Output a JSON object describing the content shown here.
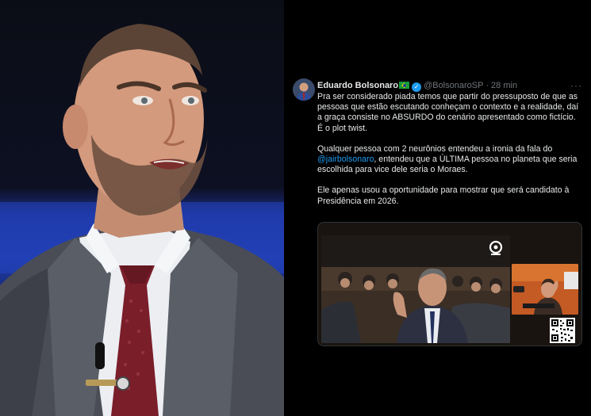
{
  "left_photo": {
    "subject": "man-in-suit-speaking",
    "colors": {
      "backdrop_blue": "#1f3aa3",
      "suit": "#4a4d55",
      "tie": "#7a1e2a"
    }
  },
  "tweet": {
    "author_name": "Eduardo Bolsonaro",
    "flag_icon": "brazil-flag-icon",
    "verified_icon": "verified-badge-icon",
    "handle": "@BolsonaroSP",
    "separator": "·",
    "time": "28 min",
    "more_icon": "···",
    "paragraph_1": "Pra ser considerado piada temos que partir do pressuposto de que as pessoas que estão escutando conheçam o contexto e a realidade, daí a graça consiste no ABSURDO do cenário apresentado como fictício. É o plot twist.",
    "paragraph_2_pre": "Qualquer pessoa com 2 neurônios entendeu a ironia da fala do ",
    "paragraph_2_mention": "@jairbolsonaro",
    "paragraph_2_post": ", entendeu que a ÚLTIMA pessoa no planeta que seria escolhida para vice dele seria o Moraes.",
    "paragraph_3": "Ele apenas usou a oportunidade para mostrar que será candidato à Presidência em 2026.",
    "media": {
      "description_icon": "video-thumbnail",
      "tv_logo_icon": "tv-channel-logo-icon",
      "qr_icon": "qr-code-icon"
    },
    "colors": {
      "accent": "#1d9bf0",
      "text": "#e7e9ea",
      "muted": "#71767b",
      "background": "#000000"
    }
  }
}
